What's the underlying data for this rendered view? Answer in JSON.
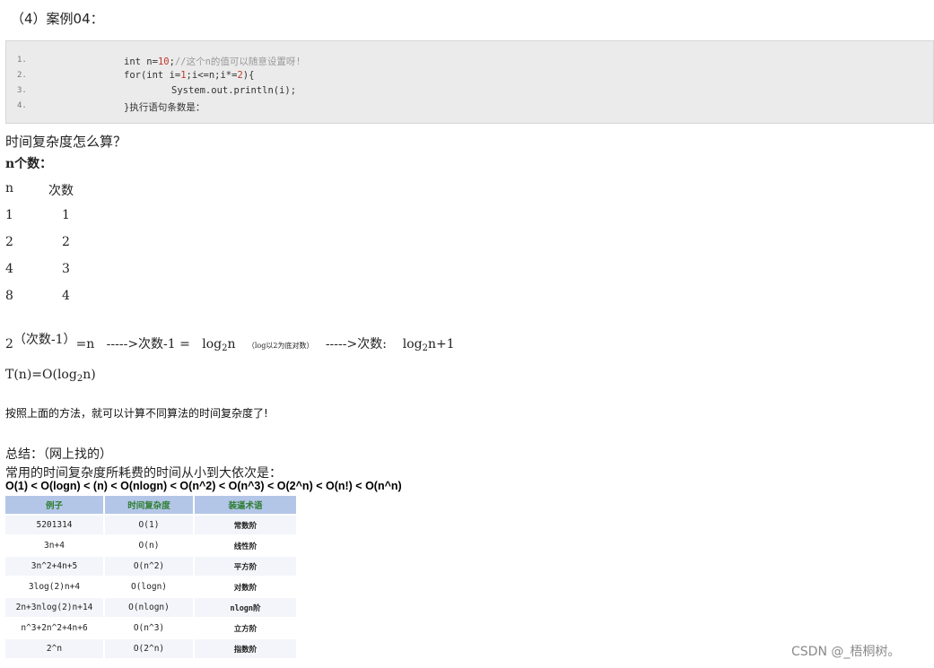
{
  "heading": "（4）案例04：",
  "code": {
    "lines": [
      {
        "no": "1.",
        "parts": [
          {
            "t": "int n=",
            "c": ""
          },
          {
            "t": "10",
            "c": "num"
          },
          {
            "t": ";",
            "c": ""
          },
          {
            "t": "//这个n的值可以随意设置呀!",
            "c": "cm"
          }
        ]
      },
      {
        "no": "2.",
        "parts": [
          {
            "t": "for(int i=",
            "c": ""
          },
          {
            "t": "1",
            "c": "num"
          },
          {
            "t": ";i<=n;i*=",
            "c": ""
          },
          {
            "t": "2",
            "c": "num"
          },
          {
            "t": "){",
            "c": ""
          }
        ]
      },
      {
        "no": "3.",
        "parts": [
          {
            "t": "System.out.println(i);",
            "c": ""
          }
        ]
      },
      {
        "no": "4.",
        "parts": [
          {
            "t": "}执行语句条数是：",
            "c": ""
          }
        ]
      }
    ]
  },
  "question": "时间复杂度怎么算？",
  "n_count_label": "n个数：",
  "count_table": {
    "headers": [
      "n",
      "次数"
    ],
    "rows": [
      [
        "1",
        "1"
      ],
      [
        "2",
        "2"
      ],
      [
        "4",
        "3"
      ],
      [
        "8",
        "4"
      ]
    ]
  },
  "formula": {
    "base": "2",
    "exponent": "（次数-1）",
    "eq_n": "=n",
    "arrow1": "----->次数-1 =",
    "log_a": "log",
    "log_a_sub": "2",
    "log_a_arg": "n",
    "note": "（log以2为底对数）",
    "arrow2": "----->次数:",
    "log_b": "log",
    "log_b_sub": "2",
    "log_b_arg": "n+1"
  },
  "tn": {
    "prefix": "T(n)=O(log",
    "sub": "2",
    "suffix": "n)"
  },
  "method_note": "按照上面的方法，就可以计算不同算法的时间复杂度了!",
  "summary": "总结：（网上找的）",
  "summary2": "常用的时间复杂度所耗费的时间从小到大依次是：",
  "order": "O(1) < O(logn) < (n) < O(nlogn) < O(n^2) < O(n^3) < O(2^n) < O(n!) < O(n^n)",
  "complexity_table": {
    "headers": [
      "例子",
      "时间复杂度",
      "装逼术语"
    ],
    "rows": [
      [
        "5201314",
        "O(1)",
        "常数阶"
      ],
      [
        "3n+4",
        "O(n)",
        "线性阶"
      ],
      [
        "3n^2+4n+5",
        "O(n^2)",
        "平方阶"
      ],
      [
        "3log(2)n+4",
        "O(logn)",
        "对数阶"
      ],
      [
        "2n+3nlog(2)n+14",
        "O(nlogn)",
        "nlogn阶"
      ],
      [
        "n^3+2n^2+4n+6",
        "O(n^3)",
        "立方阶"
      ],
      [
        "2^n",
        "O(2^n)",
        "指数阶"
      ]
    ]
  },
  "watermark": "CSDN @_梧桐树。"
}
